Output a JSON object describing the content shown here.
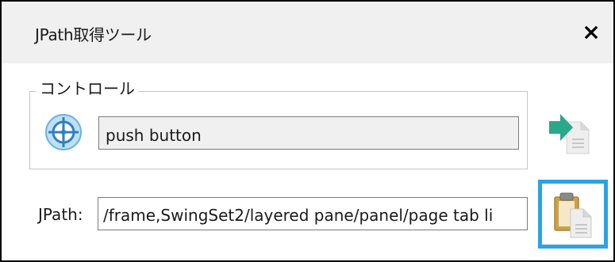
{
  "window": {
    "title": "JPath取得ツール",
    "close_glyph": "✕"
  },
  "control_group": {
    "legend": "コントロール",
    "target_icon": "crosshair-target-icon",
    "control_value": "push button",
    "insert_button_icon": "arrow-into-document-icon"
  },
  "jpath": {
    "label": "JPath:",
    "value": "/frame,SwingSet2/layered pane/panel/page tab li",
    "copy_button_icon": "clipboard-copy-icon"
  },
  "colors": {
    "accent_focus": "#29a4e3",
    "arrow_green": "#2aa88a",
    "target_blue": "#3a8fd0",
    "clipboard_tan": "#c9a24a"
  }
}
